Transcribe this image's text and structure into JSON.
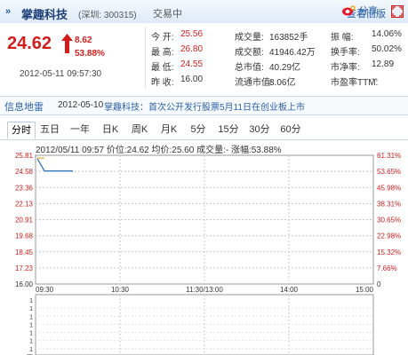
{
  "header": {
    "name": "掌趣科技",
    "code": "(深圳: 300315)",
    "status": "交易中",
    "old_version_link": "查看旧版"
  },
  "quote": {
    "price": "24.62",
    "change": "8.62",
    "change_pct": "53.88%",
    "datetime": "2012-05-11 09:57:30",
    "fields": [
      {
        "label": "今  开:",
        "value": "25.56",
        "color": "red"
      },
      {
        "label": "成交量:",
        "value": "163852手",
        "color": "black"
      },
      {
        "label": "振  幅:",
        "value": "14.06%",
        "color": "black"
      },
      {
        "label": "最  高:",
        "value": "26.80",
        "color": "red"
      },
      {
        "label": "成交额:",
        "value": "41946.42万",
        "color": "black"
      },
      {
        "label": "换手率:",
        "value": "50.02%",
        "color": "black"
      },
      {
        "label": "最  低:",
        "value": "24.55",
        "color": "red"
      },
      {
        "label": "总市值:",
        "value": "40.29亿",
        "color": "black"
      },
      {
        "label": "市净率:",
        "value": "12.89",
        "color": "black"
      },
      {
        "label": "昨  收:",
        "value": "16.00",
        "color": "black"
      },
      {
        "label": "流通市值:",
        "value": "8.06亿",
        "color": "black"
      },
      {
        "label": "市盈率TTM:",
        "value": "--",
        "color": "black"
      }
    ]
  },
  "news": {
    "title": "信息地雷",
    "date": "2012-05-10",
    "text": "掌趣科技：首次公开发行股票5月11日在创业板上市"
  },
  "tabs": [
    "分时",
    "五日",
    "一年",
    "日K",
    "周K",
    "月K",
    "5分",
    "15分",
    "30分",
    "60分"
  ],
  "active_tab": "分时",
  "share_label": "分享",
  "chart_info": {
    "time": "2012/05/11 09:57",
    "price": "价位:24.62",
    "avg": "均价:25.60",
    "volume": "成交量:-",
    "change": "涨幅:53.88%"
  },
  "chart_data": {
    "type": "line",
    "x_ticks": [
      "09:30",
      "10:30",
      "11:30/13:00",
      "14:00",
      "15:00"
    ],
    "y_ticks_left": [
      "25.81",
      "24.58",
      "23.36",
      "22.13",
      "20.91",
      "19.68",
      "18.45",
      "17.23",
      "16.00"
    ],
    "y_ticks_right": [
      "61.31%",
      "53.65%",
      "45.98%",
      "38.31%",
      "30.65%",
      "22.98%",
      "15.32%",
      "7.66%",
      "0"
    ],
    "ylim": [
      16.0,
      25.81
    ],
    "series": [
      {
        "values": [
          25.56,
          24.62,
          24.62,
          24.62,
          24.62,
          24.62
        ]
      }
    ],
    "volume_ticks": [
      "1",
      "1",
      "1",
      "1",
      "1",
      "1",
      "1",
      "万"
    ]
  },
  "colors": {
    "up": "#d21d1d",
    "down": "#118811",
    "link": "#2a5fa8"
  }
}
